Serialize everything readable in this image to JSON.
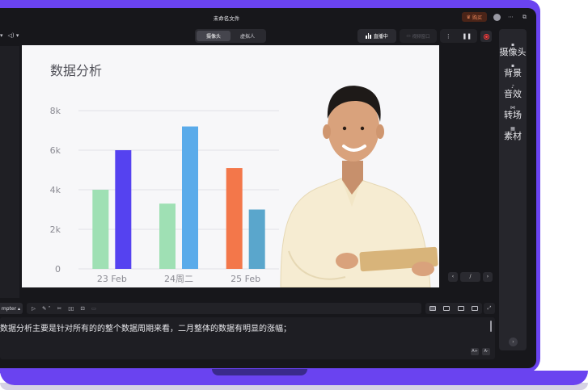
{
  "window": {
    "title": "未命名文件",
    "vip_label": "购买"
  },
  "toolbar": {
    "tabs": [
      {
        "label": "摄像头",
        "active": true
      },
      {
        "label": "虚拟人",
        "active": false
      }
    ],
    "live_label": "直播中",
    "pip_label": "视频窗口"
  },
  "side_menu": [
    {
      "label": "摄像头",
      "icon": "camera-icon"
    },
    {
      "label": "背景",
      "icon": "image-icon"
    },
    {
      "label": "音效",
      "icon": "music-icon"
    },
    {
      "label": "转场",
      "icon": "transition-icon"
    },
    {
      "label": "素材",
      "icon": "assets-icon"
    }
  ],
  "pager": {
    "value": "/"
  },
  "prompter": {
    "label": "mpter",
    "text": "数据分析主要是针对所有的的整个数据周期来看，二月整体的数据有明显的涨幅；"
  },
  "font_size": {
    "increase": "A+",
    "decrease": "A-"
  },
  "colors": {
    "accent": "#6a43f0",
    "record": "#ff3b3b",
    "dark_bg": "#17171b"
  },
  "chart_data": {
    "type": "bar",
    "title": "数据分析",
    "categories": [
      "23 Feb",
      "24周二",
      "25 Feb"
    ],
    "ylim": [
      0,
      8000
    ],
    "ytick_labels": [
      "0",
      "2k",
      "4k",
      "6k",
      "8k"
    ],
    "grid": true,
    "series": [
      {
        "values": [
          4000,
          3300,
          5100
        ],
        "colors": [
          "#9fe0b4",
          "#9fe0b4",
          "#f3774a"
        ]
      },
      {
        "values": [
          6000,
          7200,
          3000
        ],
        "colors": [
          "#5542f0",
          "#5aabea",
          "#5aa6cc"
        ]
      }
    ]
  }
}
